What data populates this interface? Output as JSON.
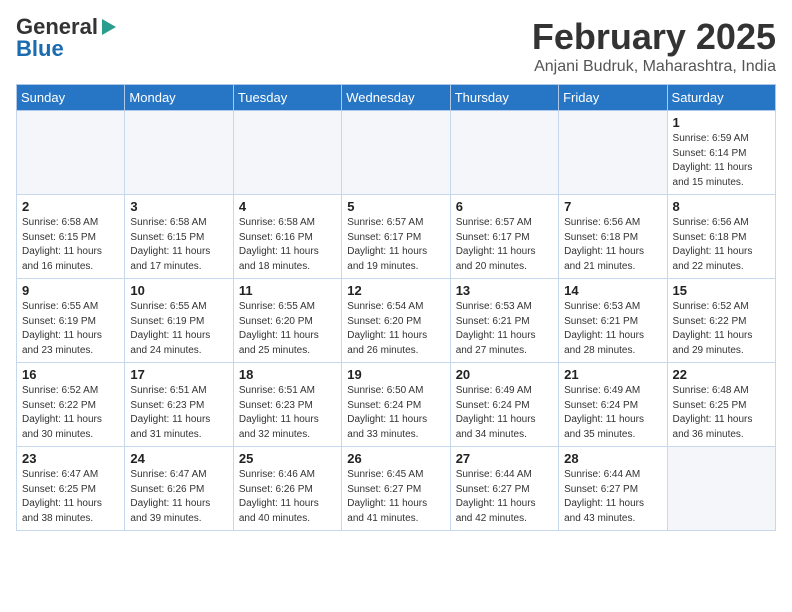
{
  "logo": {
    "text_general": "General",
    "text_blue": "Blue"
  },
  "title": {
    "month": "February 2025",
    "location": "Anjani Budruk, Maharashtra, India"
  },
  "headers": [
    "Sunday",
    "Monday",
    "Tuesday",
    "Wednesday",
    "Thursday",
    "Friday",
    "Saturday"
  ],
  "weeks": [
    [
      {
        "day": "",
        "info": ""
      },
      {
        "day": "",
        "info": ""
      },
      {
        "day": "",
        "info": ""
      },
      {
        "day": "",
        "info": ""
      },
      {
        "day": "",
        "info": ""
      },
      {
        "day": "",
        "info": ""
      },
      {
        "day": "1",
        "info": "Sunrise: 6:59 AM\nSunset: 6:14 PM\nDaylight: 11 hours\nand 15 minutes."
      }
    ],
    [
      {
        "day": "2",
        "info": "Sunrise: 6:58 AM\nSunset: 6:15 PM\nDaylight: 11 hours\nand 16 minutes."
      },
      {
        "day": "3",
        "info": "Sunrise: 6:58 AM\nSunset: 6:15 PM\nDaylight: 11 hours\nand 17 minutes."
      },
      {
        "day": "4",
        "info": "Sunrise: 6:58 AM\nSunset: 6:16 PM\nDaylight: 11 hours\nand 18 minutes."
      },
      {
        "day": "5",
        "info": "Sunrise: 6:57 AM\nSunset: 6:17 PM\nDaylight: 11 hours\nand 19 minutes."
      },
      {
        "day": "6",
        "info": "Sunrise: 6:57 AM\nSunset: 6:17 PM\nDaylight: 11 hours\nand 20 minutes."
      },
      {
        "day": "7",
        "info": "Sunrise: 6:56 AM\nSunset: 6:18 PM\nDaylight: 11 hours\nand 21 minutes."
      },
      {
        "day": "8",
        "info": "Sunrise: 6:56 AM\nSunset: 6:18 PM\nDaylight: 11 hours\nand 22 minutes."
      }
    ],
    [
      {
        "day": "9",
        "info": "Sunrise: 6:55 AM\nSunset: 6:19 PM\nDaylight: 11 hours\nand 23 minutes."
      },
      {
        "day": "10",
        "info": "Sunrise: 6:55 AM\nSunset: 6:19 PM\nDaylight: 11 hours\nand 24 minutes."
      },
      {
        "day": "11",
        "info": "Sunrise: 6:55 AM\nSunset: 6:20 PM\nDaylight: 11 hours\nand 25 minutes."
      },
      {
        "day": "12",
        "info": "Sunrise: 6:54 AM\nSunset: 6:20 PM\nDaylight: 11 hours\nand 26 minutes."
      },
      {
        "day": "13",
        "info": "Sunrise: 6:53 AM\nSunset: 6:21 PM\nDaylight: 11 hours\nand 27 minutes."
      },
      {
        "day": "14",
        "info": "Sunrise: 6:53 AM\nSunset: 6:21 PM\nDaylight: 11 hours\nand 28 minutes."
      },
      {
        "day": "15",
        "info": "Sunrise: 6:52 AM\nSunset: 6:22 PM\nDaylight: 11 hours\nand 29 minutes."
      }
    ],
    [
      {
        "day": "16",
        "info": "Sunrise: 6:52 AM\nSunset: 6:22 PM\nDaylight: 11 hours\nand 30 minutes."
      },
      {
        "day": "17",
        "info": "Sunrise: 6:51 AM\nSunset: 6:23 PM\nDaylight: 11 hours\nand 31 minutes."
      },
      {
        "day": "18",
        "info": "Sunrise: 6:51 AM\nSunset: 6:23 PM\nDaylight: 11 hours\nand 32 minutes."
      },
      {
        "day": "19",
        "info": "Sunrise: 6:50 AM\nSunset: 6:24 PM\nDaylight: 11 hours\nand 33 minutes."
      },
      {
        "day": "20",
        "info": "Sunrise: 6:49 AM\nSunset: 6:24 PM\nDaylight: 11 hours\nand 34 minutes."
      },
      {
        "day": "21",
        "info": "Sunrise: 6:49 AM\nSunset: 6:24 PM\nDaylight: 11 hours\nand 35 minutes."
      },
      {
        "day": "22",
        "info": "Sunrise: 6:48 AM\nSunset: 6:25 PM\nDaylight: 11 hours\nand 36 minutes."
      }
    ],
    [
      {
        "day": "23",
        "info": "Sunrise: 6:47 AM\nSunset: 6:25 PM\nDaylight: 11 hours\nand 38 minutes."
      },
      {
        "day": "24",
        "info": "Sunrise: 6:47 AM\nSunset: 6:26 PM\nDaylight: 11 hours\nand 39 minutes."
      },
      {
        "day": "25",
        "info": "Sunrise: 6:46 AM\nSunset: 6:26 PM\nDaylight: 11 hours\nand 40 minutes."
      },
      {
        "day": "26",
        "info": "Sunrise: 6:45 AM\nSunset: 6:27 PM\nDaylight: 11 hours\nand 41 minutes."
      },
      {
        "day": "27",
        "info": "Sunrise: 6:44 AM\nSunset: 6:27 PM\nDaylight: 11 hours\nand 42 minutes."
      },
      {
        "day": "28",
        "info": "Sunrise: 6:44 AM\nSunset: 6:27 PM\nDaylight: 11 hours\nand 43 minutes."
      },
      {
        "day": "",
        "info": ""
      }
    ]
  ]
}
